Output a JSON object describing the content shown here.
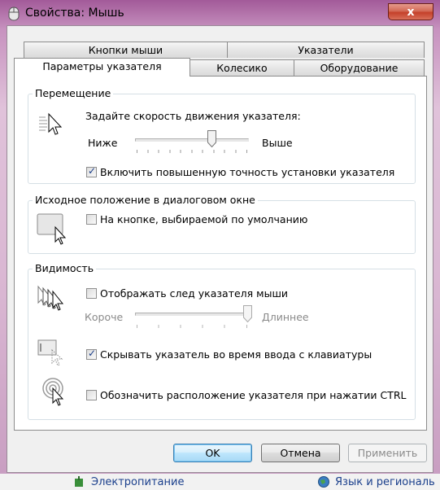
{
  "window": {
    "title": "Свойства: Мышь",
    "close_label": "x"
  },
  "tabs": {
    "row1": [
      "Кнопки мыши",
      "Указатели"
    ],
    "row2": [
      "Параметры указателя",
      "Колесико",
      "Оборудование"
    ],
    "active": "Параметры указателя"
  },
  "motion": {
    "group_title": "Перемещение",
    "speed_label": "Задайте скорость движения указателя:",
    "slow_label": "Ниже",
    "fast_label": "Выше",
    "speed_value": 0.68,
    "precision_label": "Включить повышенную точность установки указателя",
    "precision_checked": true
  },
  "snap_to": {
    "group_title": "Исходное положение в диалоговом окне",
    "default_button_label": "На кнопке, выбираемой по умолчанию",
    "checked": false
  },
  "visibility": {
    "group_title": "Видимость",
    "trails_label": "Отображать след указателя мыши",
    "trails_checked": false,
    "short_label": "Короче",
    "long_label": "Длиннее",
    "trails_value": 1.0,
    "hide_label": "Скрывать указатель во время ввода с клавиатуры",
    "hide_checked": true,
    "ctrl_label": "Обозначить расположение указателя при нажатии CTRL",
    "ctrl_checked": false
  },
  "buttons": {
    "ok": "OK",
    "cancel": "Отмена",
    "apply": "Применить"
  },
  "background_items": [
    "Электропитание",
    "Язык и региональ"
  ]
}
